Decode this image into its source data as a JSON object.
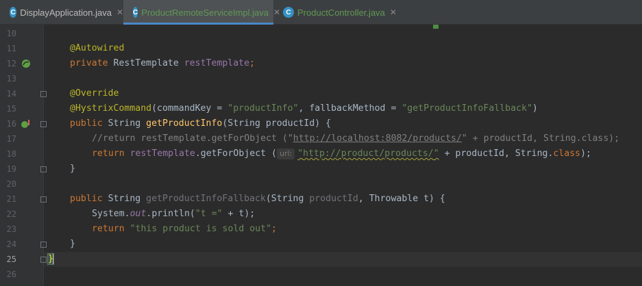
{
  "tabs": [
    {
      "label": "DisplayApplication.java",
      "active": false,
      "icon": "spring-boot-app-icon"
    },
    {
      "label": "ProductRemoteServiceImpl.java",
      "active": true,
      "icon": "class-icon"
    },
    {
      "label": "ProductController.java",
      "active": false,
      "icon": "class-icon"
    }
  ],
  "line_numbers": [
    "10",
    "11",
    "12",
    "13",
    "14",
    "15",
    "16",
    "17",
    "18",
    "19",
    "20",
    "21",
    "22",
    "23",
    "24",
    "25",
    "26"
  ],
  "current_line": "25",
  "code": {
    "l11": "@Autowired",
    "l12_kw": "private ",
    "l12_type": "RestTemplate ",
    "l12_field": "restTemplate",
    "l12_end": ";",
    "l14": "@Override",
    "l15_ann": "@HystrixCommand",
    "l15_a": "(commandKey = ",
    "l15_s1": "\"productInfo\"",
    "l15_b": ", fallbackMethod = ",
    "l15_s2": "\"getProductInfoFallback\"",
    "l15_c": ")",
    "l16_kw": "public ",
    "l16_type": "String ",
    "l16_m": "getProductInfo",
    "l16_rest": "(String productId) {",
    "l17_a": "//return restTemplate.getForObject (\"",
    "l17_url": "http://localhost:8082/products/",
    "l17_b": "\" + productId, String.class);",
    "l18_kw": "return ",
    "l18_f": "restTemplate",
    "l18_a": ".getForObject (",
    "l18_hint": "url:",
    "l18_s_q1": "\"",
    "l18_url": "http://product/products/",
    "l18_s_q2": "\"",
    "l18_b": " + productId, String.",
    "l18_kw2": "class",
    "l18_c": ");",
    "l19": "}",
    "l21_kw": "public ",
    "l21_type": "String ",
    "l21_m": "getProductInfoFallback",
    "l21_a": "(String ",
    "l21_p1": "productId",
    "l21_b": ", Throwable t) {",
    "l22_a": "System.",
    "l22_out": "out",
    "l22_b": ".println(",
    "l22_s": "\"t =\"",
    "l22_c": " + t);",
    "l23_kw": "return ",
    "l23_s": "\"this product is sold out\"",
    "l23_end": ";",
    "l24": "}",
    "l25": "}"
  },
  "colors": {
    "background": "#2b2b2b",
    "gutter": "#313335",
    "keyword": "#cc7832",
    "string": "#6a8759",
    "annotation": "#bbb529",
    "field": "#9876aa",
    "method": "#ffc66d",
    "comment": "#808080",
    "default_text": "#a9b7c6",
    "active_tab_underline": "#4a88c7"
  }
}
